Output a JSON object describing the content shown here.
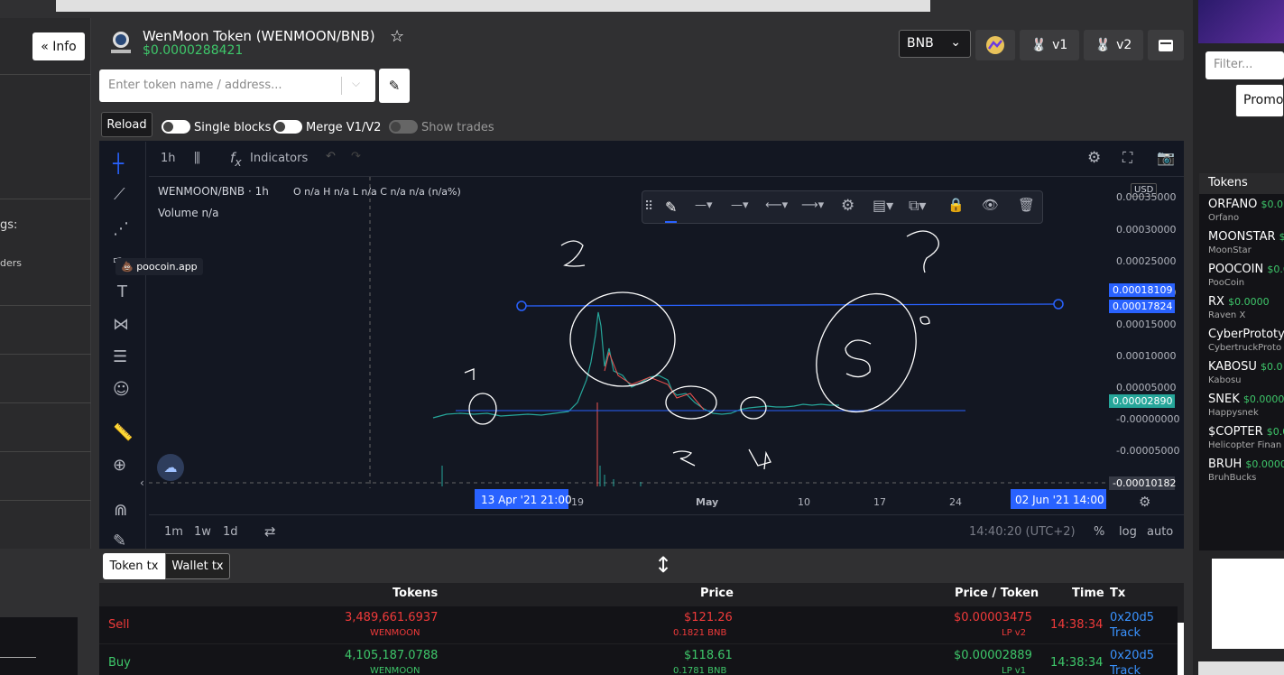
{
  "info_button": "« Info",
  "left_panel": {
    "text1": "gs:",
    "text2": "ders"
  },
  "token": {
    "title": "WenMoon Token (WENMOON/BNB)",
    "price": "$0.0000288421"
  },
  "search": {
    "placeholder": "Enter token name / address..."
  },
  "network": {
    "selected": "BNB"
  },
  "top_buttons": {
    "v1": "v1",
    "v2": "v2"
  },
  "controls": {
    "reload": "Reload",
    "single_blocks": "Single blocks",
    "merge": "Merge V1/V2",
    "show_trades": "Show trades"
  },
  "chart": {
    "interval": "1h",
    "indicators": "Indicators",
    "legend_pair": "WENMOON/BNB · 1h",
    "legend_ohlc": "O n/a  H n/a  L n/a  C n/a  n/a (n/a%)",
    "legend_volume": "Volume  n/a",
    "currency": "USD",
    "watermark": "poocoin.app",
    "y_ticks": [
      "0.00030000",
      "0.00025000",
      "0.00020000",
      "0.00015000",
      "0.00010000",
      "0.00005000",
      "-0.00000000",
      "-0.00005000"
    ],
    "price_labels": [
      "0.00018109",
      "0.00017824",
      "0.00002890",
      "-0.00010182"
    ],
    "x_ticks": [
      "19",
      "May",
      "10",
      "17",
      "24"
    ],
    "x_start": "13 Apr '21   21:00",
    "x_end": "02 Jun '21   14:00",
    "ranges": [
      "1m",
      "1w",
      "1d"
    ],
    "clock": "14:40:20 (UTC+2)",
    "scale": {
      "pct": "%",
      "log": "log",
      "auto": "auto"
    },
    "annotations": [
      "1",
      "2",
      "3",
      "4",
      "5",
      "?"
    ]
  },
  "tx_tabs": {
    "token": "Token tx",
    "wallet": "Wallet tx"
  },
  "table": {
    "headers": {
      "tokens": "Tokens",
      "price": "Price",
      "price_token": "Price / Token",
      "time": "Time",
      "tx": "Tx"
    },
    "rows": [
      {
        "type": "Sell",
        "tokens": "3,489,661.6937",
        "tokens_sub": "WENMOON",
        "price": "$121.26",
        "price_sub": "0.1821 BNB",
        "pt": "$0.00003475",
        "pt_sub": "LP v2",
        "time": "14:38:34",
        "tx": "0x20d5",
        "track": "Track"
      },
      {
        "type": "Buy",
        "tokens": "4,105,187.0788",
        "tokens_sub": "WENMOON",
        "price": "$118.61",
        "price_sub": "0.1781 BNB",
        "pt": "$0.00002889",
        "pt_sub": "LP v1",
        "time": "14:38:34",
        "tx": "0x20d5",
        "track": "Track"
      }
    ]
  },
  "right_panel": {
    "filter_placeholder": "Filter...",
    "promote": "Promote",
    "tokens_header": "Tokens",
    "tokens": [
      {
        "sym": "ORFANO",
        "price": "$0.0",
        "name": "Orfano"
      },
      {
        "sym": "MOONSTAR",
        "price": "$",
        "name": "MoonStar"
      },
      {
        "sym": "POOCOIN",
        "price": "$0.0",
        "name": "PooCoin"
      },
      {
        "sym": "RX",
        "price": "$0.0000",
        "name": "Raven X"
      },
      {
        "sym": "CyberPrototyp",
        "price": "",
        "name": "CybertruckProto"
      },
      {
        "sym": "KABOSU",
        "price": "$0.0",
        "name": "Kabosu"
      },
      {
        "sym": "SNEK",
        "price": "$0.0000",
        "name": "Happysnek"
      },
      {
        "sym": "$COPTER",
        "price": "$0.0",
        "name": "Helicopter Finan"
      },
      {
        "sym": "BRUH",
        "price": "$0.0000",
        "name": "BruhBucks"
      }
    ]
  },
  "colors": {
    "green": "#3ec76a",
    "red": "#ef3a3a",
    "blue": "#3a93ff",
    "chart_bg": "#131722",
    "accent": "#2962ff"
  }
}
